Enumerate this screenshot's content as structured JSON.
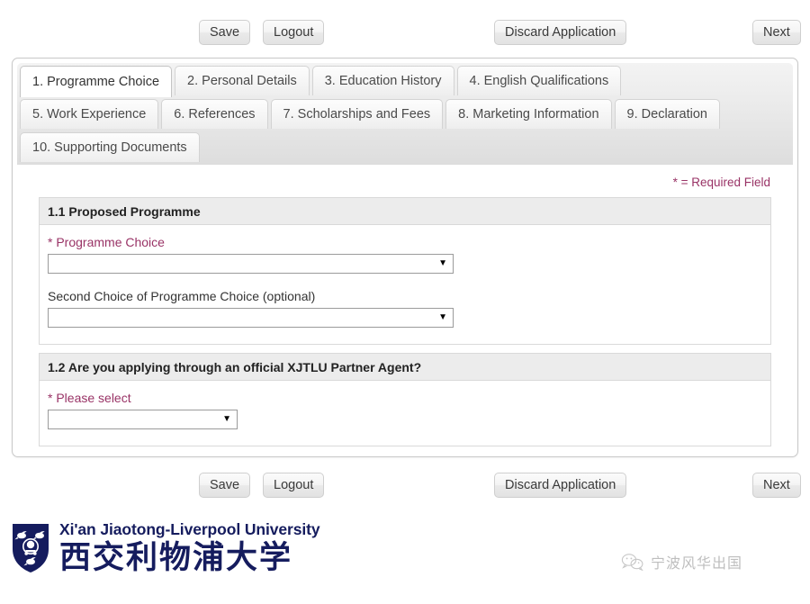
{
  "toolbar": {
    "save_label": "Save",
    "logout_label": "Logout",
    "discard_label": "Discard Application",
    "next_label": "Next"
  },
  "tabs": [
    {
      "label": "1. Programme Choice",
      "active": true
    },
    {
      "label": "2. Personal Details",
      "active": false
    },
    {
      "label": "3. Education History",
      "active": false
    },
    {
      "label": "4. English Qualifications",
      "active": false
    },
    {
      "label": "5. Work Experience",
      "active": false
    },
    {
      "label": "6. References",
      "active": false
    },
    {
      "label": "7. Scholarships and Fees",
      "active": false
    },
    {
      "label": "8. Marketing Information",
      "active": false
    },
    {
      "label": "9. Declaration",
      "active": false
    },
    {
      "label": "10. Supporting Documents",
      "active": false
    }
  ],
  "form": {
    "required_note": "* = Required Field",
    "sections": [
      {
        "heading": "1.1 Proposed Programme",
        "fields": [
          {
            "label": "Programme Choice",
            "required": true,
            "asterisk": "*",
            "value": "",
            "width": "wide",
            "arrow": "▼"
          },
          {
            "label": "Second Choice of Programme Choice (optional)",
            "required": false,
            "asterisk": "",
            "value": "",
            "width": "wide",
            "arrow": "▼"
          }
        ]
      },
      {
        "heading": "1.2 Are you applying through an official XJTLU Partner Agent?",
        "fields": [
          {
            "label": "Please select",
            "required": true,
            "asterisk": "*",
            "value": "",
            "width": "narrow",
            "arrow": "▼"
          }
        ]
      }
    ]
  },
  "footer": {
    "university_en": "Xi'an Jiaotong-Liverpool University",
    "university_cn": "西交利物浦大学",
    "brand_color": "#151c5e",
    "watermark_text": "宁波风华出国"
  },
  "colors": {
    "required": "#993366",
    "section_header_bg": "#ececec",
    "panel_border": "#c8c8c8"
  }
}
